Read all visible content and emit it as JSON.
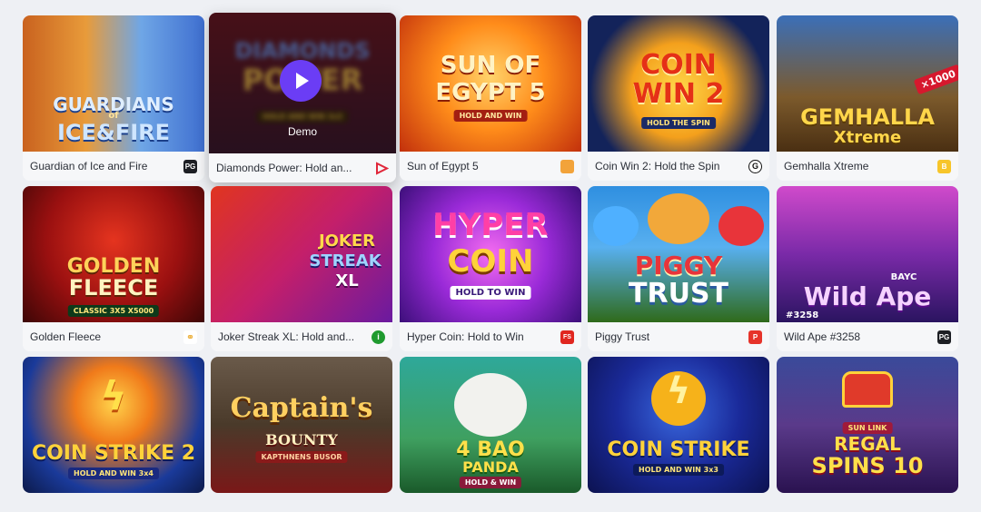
{
  "games": [
    {
      "name": "Guardian of Ice and Fire",
      "provider": "PG",
      "title_lines": [
        "GUARDIANS",
        "of",
        "ICE&FIRE"
      ],
      "sub": ""
    },
    {
      "name": "Diamonds Power: Hold an...",
      "provider": "",
      "title_lines": [
        "DIAMONDS",
        "POWER"
      ],
      "sub": "HOLD AND WIN 3x3",
      "demo_label": "Demo"
    },
    {
      "name": "Sun of Egypt 5",
      "provider": "",
      "title_lines": [
        "SUN OF",
        "EGYPT 5"
      ],
      "sub": "HOLD AND WIN"
    },
    {
      "name": "Coin Win 2: Hold the Spin",
      "provider": "G",
      "title_lines": [
        "COIN",
        "WIN 2"
      ],
      "sub": "HOLD THE SPIN"
    },
    {
      "name": "Gemhalla Xtreme",
      "provider": "B",
      "title_lines": [
        "GEMHALLA",
        "Xtreme"
      ],
      "sub": "×1000"
    },
    {
      "name": "Golden Fleece",
      "provider": "",
      "title_lines": [
        "GOLDEN",
        "FLEECE"
      ],
      "sub": "CLASSIC 3X5  X5000"
    },
    {
      "name": "Joker Streak XL: Hold and...",
      "provider": "",
      "title_lines": [
        "JOKER",
        "STREAK",
        "XL"
      ],
      "sub": ""
    },
    {
      "name": "Hyper Coin: Hold to Win",
      "provider": "FS",
      "title_lines": [
        "HYPER",
        "COIN"
      ],
      "sub": "HOLD TO WIN"
    },
    {
      "name": "Piggy Trust",
      "provider": "P",
      "title_lines": [
        "PIGGY",
        "TRUST"
      ],
      "sub": ""
    },
    {
      "name": "Wild Ape #3258",
      "provider": "PG",
      "title_lines": [
        "BAYC",
        "Wild Ape",
        "#3258"
      ],
      "sub": ""
    },
    {
      "name": "",
      "provider": "",
      "title_lines": [
        "COIN STRIKE 2"
      ],
      "sub": "HOLD AND WIN 3x4"
    },
    {
      "name": "",
      "provider": "",
      "title_lines": [
        "Captain's",
        "BOUNTY"
      ],
      "sub": "KAPTHNENS BUSOR"
    },
    {
      "name": "",
      "provider": "",
      "title_lines": [
        "4 BAO",
        "PANDA"
      ],
      "sub": "HOLD & WIN"
    },
    {
      "name": "",
      "provider": "",
      "title_lines": [
        "COIN STRIKE"
      ],
      "sub": "HOLD AND WIN 3x3"
    },
    {
      "name": "",
      "provider": "",
      "title_lines": [
        "SUN LINK",
        "REGAL",
        "SPINS 10"
      ],
      "sub": ""
    }
  ],
  "colors": {
    "page_bg": "#eef0f4",
    "caption_bg": "#f6f7f9",
    "play_button": "#6b3df5"
  }
}
